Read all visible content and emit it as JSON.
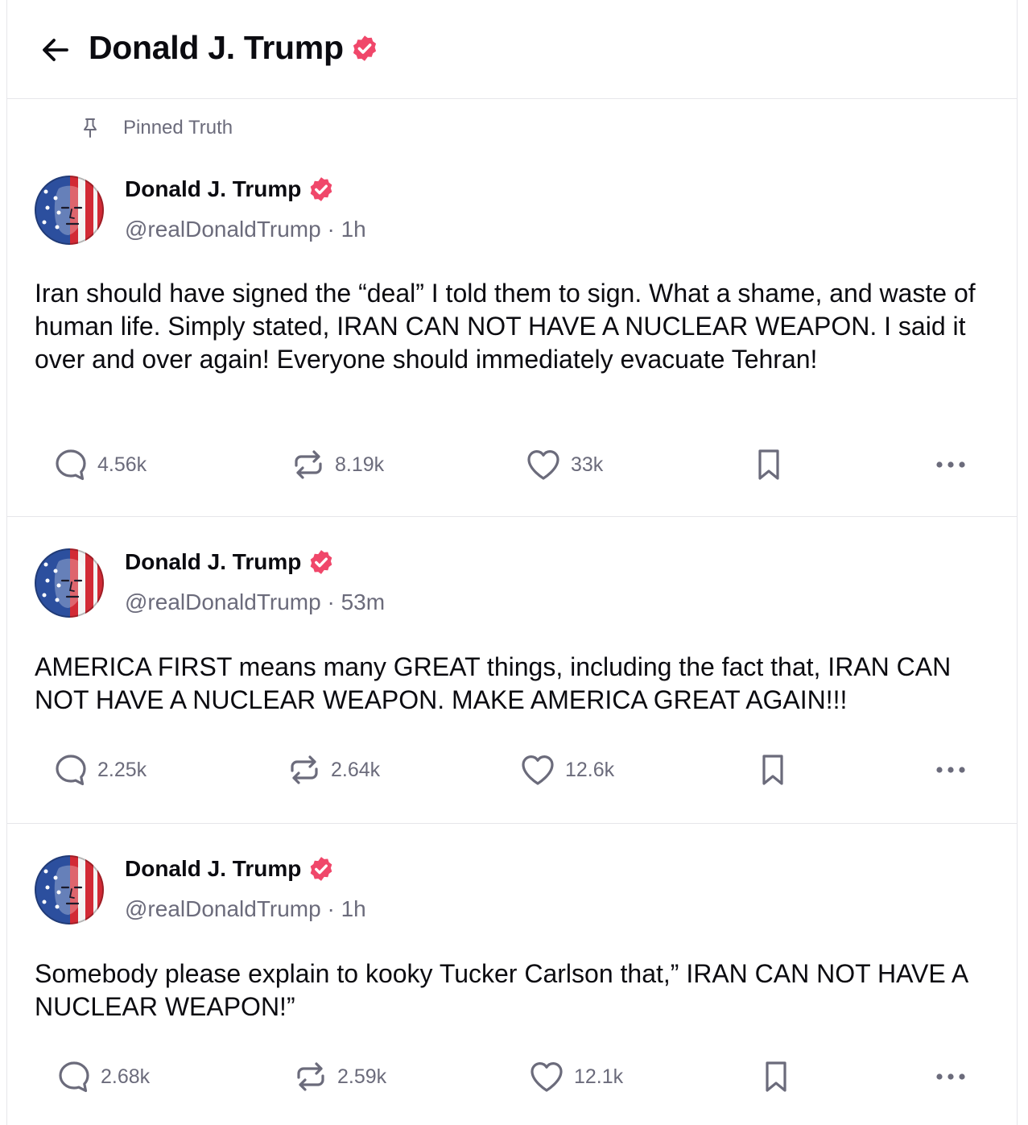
{
  "header": {
    "title": "Donald J. Trump"
  },
  "pinned_label": "Pinned Truth",
  "colors": {
    "verified": "#f0476a",
    "muted": "#6b6b7b",
    "border": "#e6e6ea",
    "text": "#0b0b10"
  },
  "icons": [
    "back-arrow-icon",
    "verified-badge-icon",
    "pin-icon",
    "reply-icon",
    "retruth-icon",
    "like-icon",
    "bookmark-icon",
    "more-icon"
  ],
  "posts": [
    {
      "author": "Donald J. Trump",
      "handle": "@realDonaldTrump",
      "time": "1h",
      "meta": "@realDonaldTrump · 1h",
      "text": "Iran should have signed the “deal” I told them to sign. What a shame, and waste of human life. Simply stated, IRAN CAN NOT HAVE A NUCLEAR WEAPON. I said it over and over again! Everyone should immediately evacuate Tehran!",
      "replies": "4.56k",
      "retruths": "8.19k",
      "likes": "33k"
    },
    {
      "author": "Donald J. Trump",
      "handle": "@realDonaldTrump",
      "time": "53m",
      "meta": "@realDonaldTrump · 53m",
      "text": "AMERICA FIRST means many GREAT things, including the fact that, IRAN CAN NOT HAVE A NUCLEAR WEAPON. MAKE AMERICA GREAT AGAIN!!!",
      "replies": "2.25k",
      "retruths": "2.64k",
      "likes": "12.6k"
    },
    {
      "author": "Donald J. Trump",
      "handle": "@realDonaldTrump",
      "time": "1h",
      "meta": "@realDonaldTrump · 1h",
      "text": "Somebody please explain to kooky Tucker Carlson that,” IRAN CAN NOT HAVE A NUCLEAR WEAPON!”",
      "replies": "2.68k",
      "retruths": "2.59k",
      "likes": "12.1k"
    }
  ]
}
